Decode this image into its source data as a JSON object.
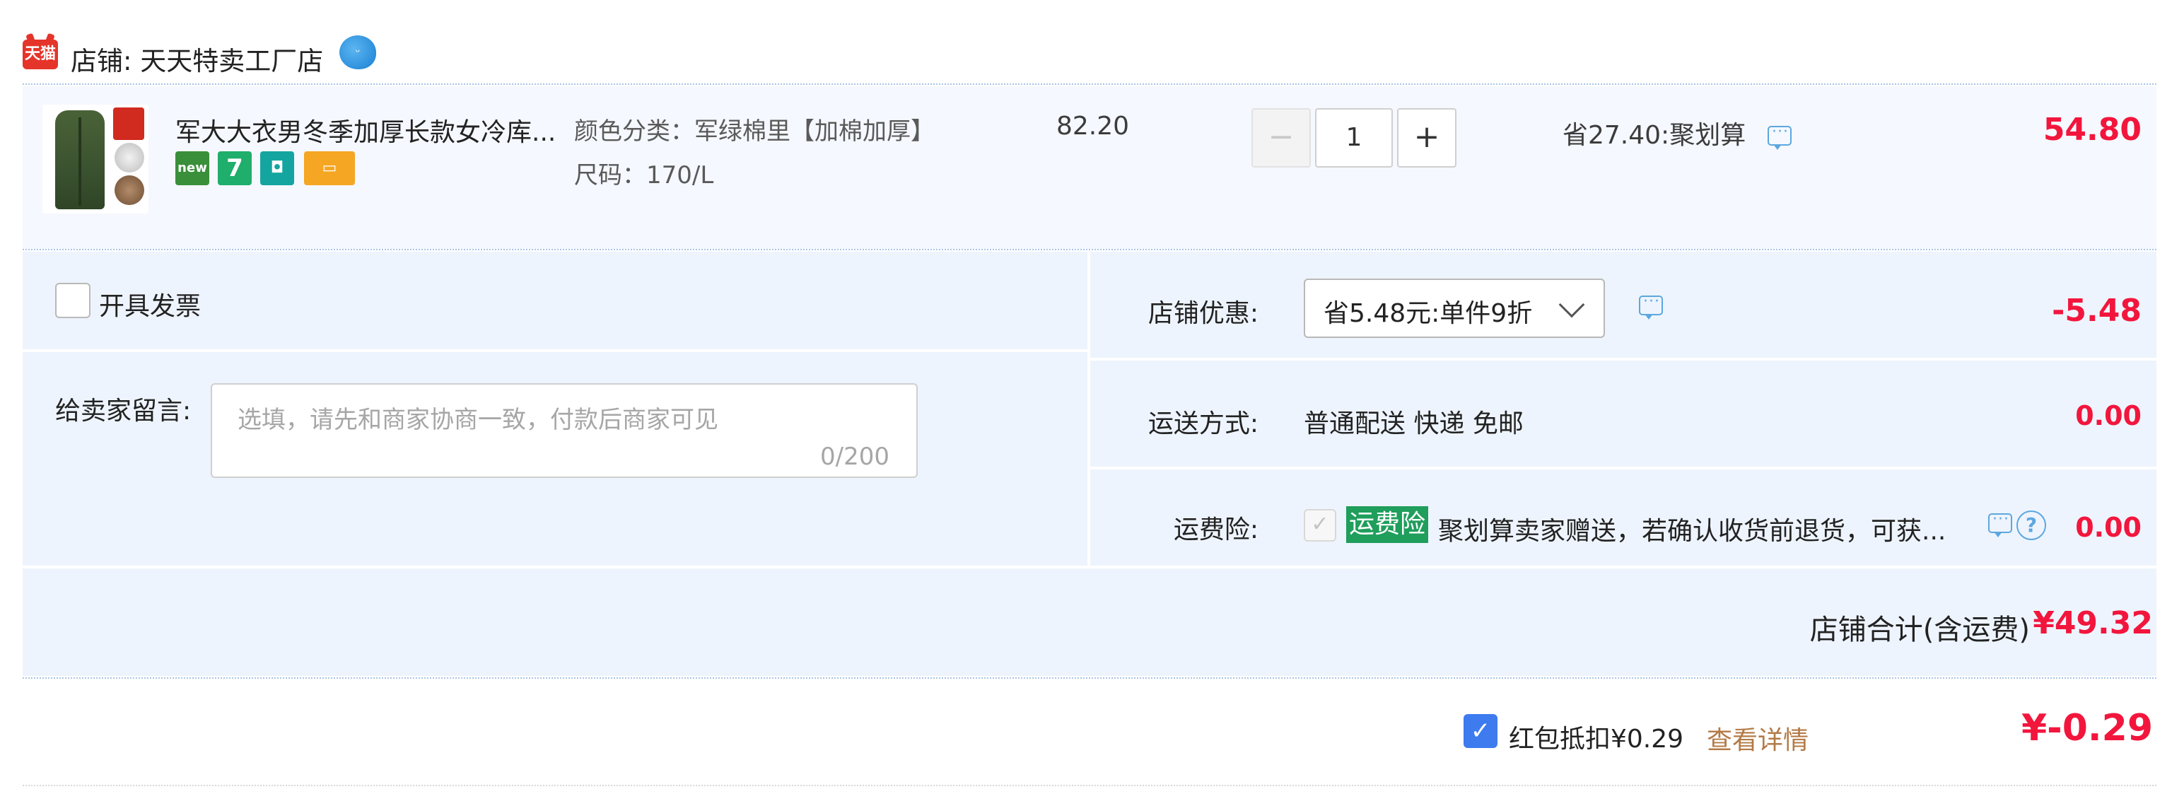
{
  "shop": {
    "logo_text": "天猫",
    "name": "店铺: 天天特卖工厂店",
    "wangwang_icon": "wangwang-chat-icon"
  },
  "item": {
    "title": "军大大衣男冬季加厚长款女冷库...",
    "sku_color": "颜色分类：军绿棉里【加棉加厚】",
    "sku_size": "尺码：170/L",
    "badges": [
      "new",
      "7",
      "bag",
      "card"
    ],
    "unit_price": "82.20",
    "quantity": "1",
    "qty_minus": "−",
    "qty_plus": "+",
    "save_text": "省27.40:聚划算",
    "total": "54.80"
  },
  "invoice": {
    "label": "开具发票",
    "checked": false
  },
  "message": {
    "label": "给卖家留言:",
    "placeholder": "选填，请先和商家协商一致，付款后商家可见",
    "count": "0/200"
  },
  "shop_discount": {
    "label": "店铺优惠:",
    "selected": "省5.48元:单件9折",
    "value": "-5.48"
  },
  "shipping": {
    "label": "运送方式:",
    "text": "普通配送 快递 免邮",
    "value": "0.00"
  },
  "insurance": {
    "label": "运费险:",
    "tag": "运费险",
    "text": "聚划算卖家赠送，若确认收货前退货，可获...",
    "checked": true,
    "value": "0.00",
    "help": "?"
  },
  "shop_total": {
    "label": "店铺合计(含运费)",
    "value": "¥49.32"
  },
  "red_packet": {
    "label": "红包抵扣¥0.29",
    "detail_link": "查看详情",
    "value": "¥-0.29",
    "checked": true
  },
  "colors": {
    "price_red": "#f2163d",
    "panel_bg": "#eef4fd",
    "item_bg": "#f5f8fe",
    "link_brown": "#b37a46",
    "insurance_green": "#1f9e5c",
    "checkbox_blue": "#3d7bef"
  }
}
